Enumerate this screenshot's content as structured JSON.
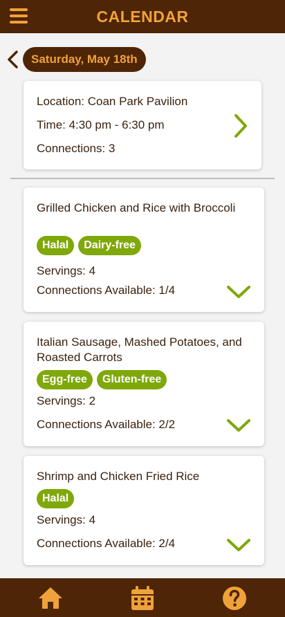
{
  "header": {
    "title": "CALENDAR",
    "menu_icon": "menu-icon"
  },
  "date_bar": {
    "date": "Saturday, May 18th",
    "back_icon": "chevron-left-icon"
  },
  "event": {
    "location": "Location: Coan Park Pavilion",
    "time": "Time: 4:30 pm - 6:30 pm",
    "connections": "Connections: 3",
    "open_icon": "chevron-right-icon"
  },
  "meals": [
    {
      "name": "Grilled Chicken and Rice with Broccoli",
      "tags": [
        "Halal",
        "Dairy-free"
      ],
      "servings": "Servings: 4",
      "connections": "Connections Available: 1/4"
    },
    {
      "name": "Italian Sausage, Mashed Potatoes, and Roasted Carrots",
      "tags": [
        "Egg-free",
        "Gluten-free"
      ],
      "servings": "Servings: 2",
      "connections": "Connections Available: 2/2"
    },
    {
      "name": "Shrimp and Chicken Fried Rice",
      "tags": [
        "Halal"
      ],
      "servings": "Servings: 4",
      "connections": "Connections Available: 2/4"
    }
  ],
  "bottom_nav": [
    "home-icon",
    "calendar-icon",
    "help-icon"
  ],
  "colors": {
    "brand_brown": "#4e2506",
    "accent_orange": "#f0a23a",
    "tag_green": "#7fa80a",
    "background": "#f3f3f3"
  }
}
